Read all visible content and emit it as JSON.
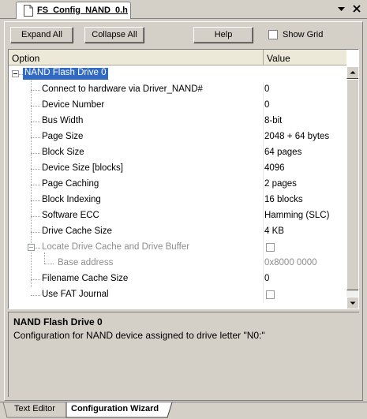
{
  "file_tab": {
    "title": "FS_Config_NAND_0.h"
  },
  "toolbar": {
    "expand_all": "Expand All",
    "collapse_all": "Collapse All",
    "help": "Help",
    "show_grid": "Show Grid",
    "show_grid_checked": false
  },
  "grid": {
    "col_option": "Option",
    "col_value": "Value",
    "rows": [
      {
        "name": "NAND Flash Drive 0",
        "value": "",
        "level": 0,
        "expanded": true,
        "selected": true
      },
      {
        "name": "Connect to hardware via Driver_NAND#",
        "value": "0",
        "level": 1
      },
      {
        "name": "Device Number",
        "value": "0",
        "level": 1
      },
      {
        "name": "Bus Width",
        "value": "8-bit",
        "level": 1
      },
      {
        "name": "Page Size",
        "value": "2048 + 64 bytes",
        "level": 1
      },
      {
        "name": "Block Size",
        "value": "64 pages",
        "level": 1
      },
      {
        "name": "Device Size [blocks]",
        "value": "4096",
        "level": 1
      },
      {
        "name": "Page Caching",
        "value": "2 pages",
        "level": 1
      },
      {
        "name": "Block Indexing",
        "value": "16 blocks",
        "level": 1
      },
      {
        "name": "Software ECC",
        "value": "Hamming (SLC)",
        "level": 1
      },
      {
        "name": "Drive Cache Size",
        "value": "4 KB",
        "level": 1
      },
      {
        "name": "Locate Drive Cache and Drive Buffer",
        "value": "",
        "level": 1,
        "checkbox": true,
        "checked": false,
        "disabled": true,
        "expanded": true
      },
      {
        "name": "Base address",
        "value": "0x8000 0000",
        "level": 2,
        "disabled": true
      },
      {
        "name": "Filename Cache Size",
        "value": "0",
        "level": 1
      },
      {
        "name": "Use FAT Journal",
        "value": "",
        "level": 1,
        "checkbox": true,
        "checked": false
      }
    ]
  },
  "description": {
    "title": "NAND Flash Drive 0",
    "text": "Configuration for NAND device assigned to drive letter \"N0:\""
  },
  "bottom_tabs": {
    "text_editor": "Text Editor",
    "configuration_wizard": "Configuration Wizard",
    "active": "configuration_wizard"
  },
  "colors": {
    "selection": "#316ac5",
    "panel": "#d4d0c8",
    "disabled_text": "#8c8c8c"
  }
}
